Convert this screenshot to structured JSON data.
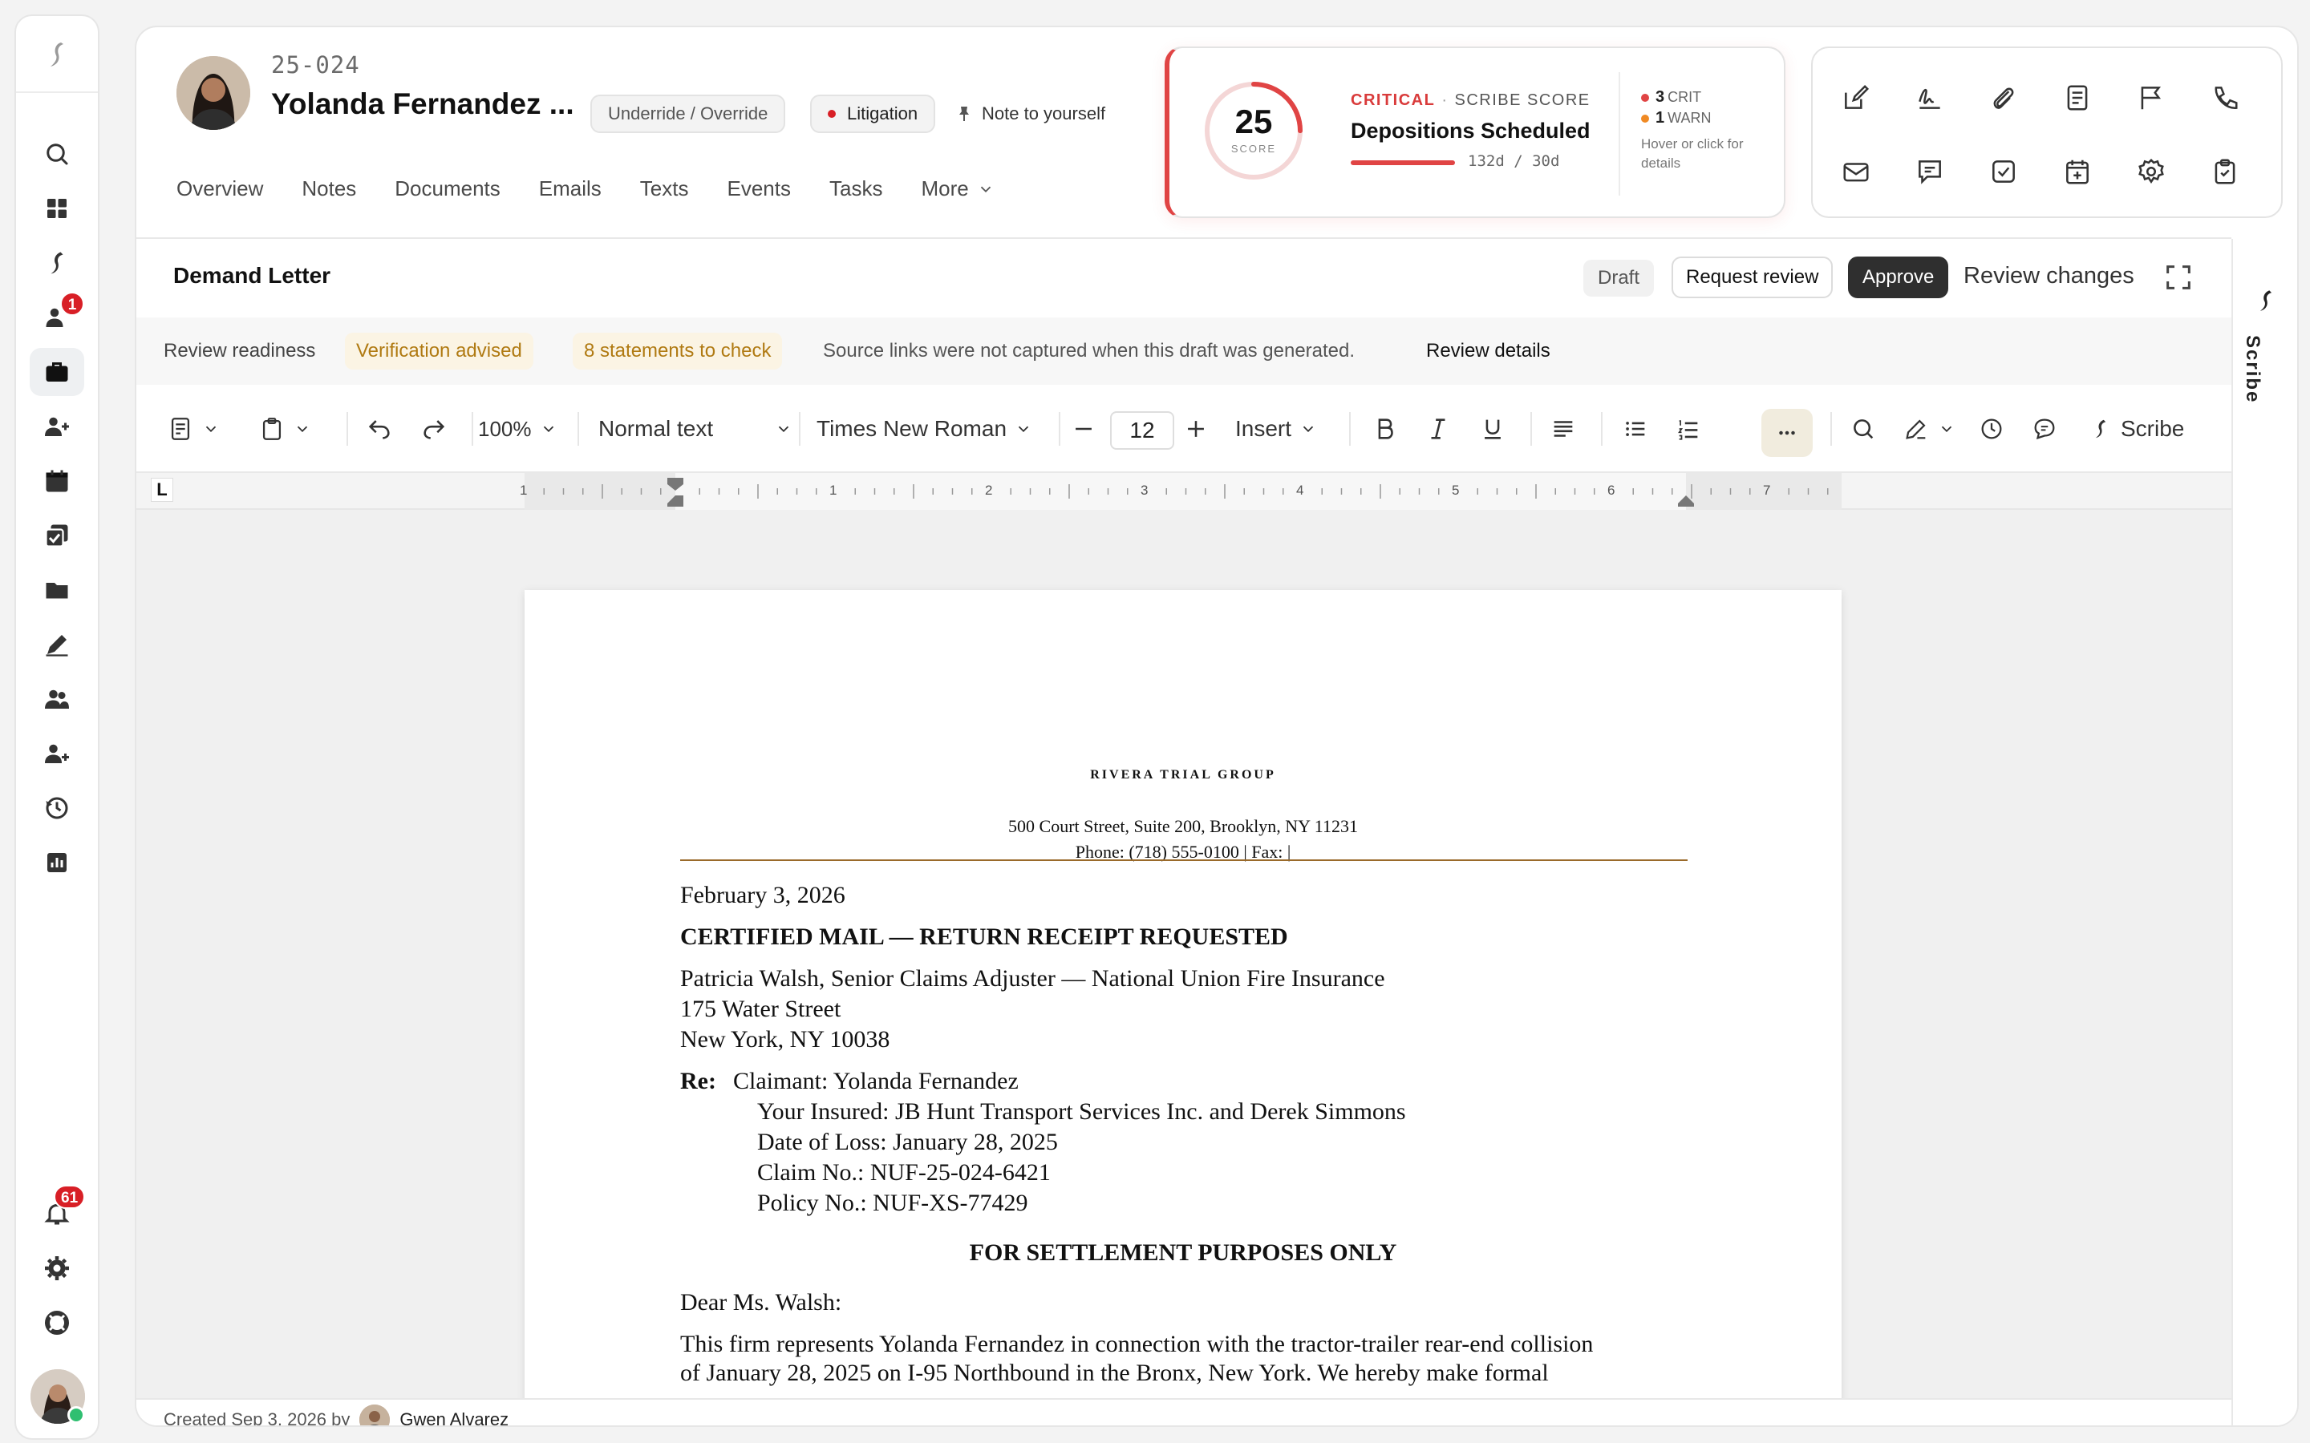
{
  "rail": {
    "badges": {
      "messages": "1",
      "notifications": "61"
    }
  },
  "case": {
    "number": "25-024",
    "name": "Yolanda Fernandez ...",
    "status_pill": "Underride / Override",
    "tag_pill": "Litigation",
    "note_label": "Note to yourself",
    "tabs": [
      "Overview",
      "Notes",
      "Documents",
      "Emails",
      "Texts",
      "Events",
      "Tasks",
      "More"
    ]
  },
  "score": {
    "value": "25",
    "label": "SCORE",
    "value_fraction": 0.25,
    "severity": "CRITICAL",
    "separator": "·",
    "heading": "SCRIBE SCORE",
    "title": "Depositions Scheduled",
    "range": "132d / 30d",
    "crit_count": "3",
    "crit_label": "CRIT",
    "warn_count": "1",
    "warn_label": "WARN",
    "hover_note": "Hover or click for details",
    "colors": {
      "critical": "#e04444",
      "warn": "#f08a24"
    }
  },
  "quick_actions": [
    "edit-icon",
    "signature-icon",
    "paperclip-icon",
    "document-icon",
    "flag-icon",
    "phone-icon",
    "mail-icon",
    "message-icon",
    "checkbox-icon",
    "calendar-plus-icon",
    "settings-icon",
    "clipboard-check-icon"
  ],
  "doc": {
    "title": "Demand Letter",
    "draft_label": "Draft",
    "request_review_label": "Request review",
    "approve_label": "Approve",
    "review_changes_label": "Review changes"
  },
  "readiness": {
    "label": "Review readiness",
    "status": "Verification advised",
    "statements": "8 statements to check",
    "message": "Source links were not captured when this draft was generated.",
    "details_link": "Review details"
  },
  "toolbar": {
    "zoom": "100%",
    "style": "Normal text",
    "font": "Times New Roman",
    "font_size": "12",
    "insert_label": "Insert",
    "scribe_label": "Scribe"
  },
  "ruler": {
    "tab_marker": "L",
    "numbers": [
      "1",
      "1",
      "2",
      "3",
      "4",
      "5",
      "6",
      "7"
    ]
  },
  "letter": {
    "firm": "RIVERA TRIAL GROUP",
    "address": "500 Court Street, Suite 200, Brooklyn, NY 11231",
    "phone": "Phone: (718) 555-0100 | Fax:  |",
    "date": "February 3, 2026",
    "certified": "CERTIFIED MAIL — RETURN RECEIPT REQUESTED",
    "recipient_line1": "Patricia Walsh, Senior Claims Adjuster — National Union Fire Insurance",
    "recipient_line2": "175 Water Street",
    "recipient_line3": "New York, NY 10038",
    "re_label": "Re:",
    "re_claimant": "Claimant: Yolanda Fernandez",
    "re_insured": "Your Insured:   JB Hunt Transport Services Inc. and Derek Simmons",
    "re_dol": "Date of Loss:   January 28, 2025",
    "re_claim": "Claim No.:   NUF-25-024-6421",
    "re_policy": "Policy No.:   NUF-XS-77429",
    "settlement": "FOR SETTLEMENT PURPOSES ONLY",
    "salutation": "Dear Ms. Walsh:",
    "body1": "This firm represents Yolanda Fernandez in connection with the tractor-trailer rear-end collision",
    "body2": "of January 28, 2025 on I-95 Northbound in the Bronx, New York. We hereby make formal"
  },
  "footer": {
    "created": "Created Sep 3, 2026 by",
    "author": "Gwen Alvarez"
  },
  "scribe_strip": {
    "label": "Scribe"
  }
}
